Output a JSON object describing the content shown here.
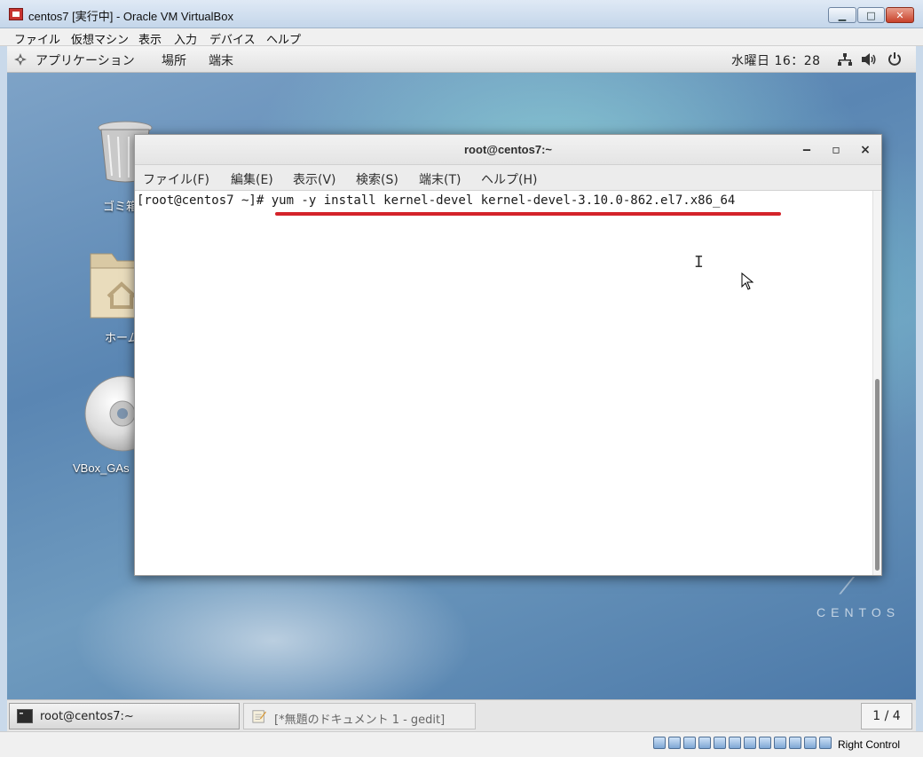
{
  "host_window": {
    "title": "centos7 [実行中] - Oracle VM VirtualBox",
    "controls": {
      "minimize": "▁",
      "maximize": "□",
      "close": "✕"
    },
    "menu": [
      "ファイル",
      "仮想マシン",
      "表示",
      "入力",
      "デバイス",
      "ヘルプ"
    ]
  },
  "gnome_topbar": {
    "applications": "アプリケーション",
    "places": "場所",
    "terminal": "端末",
    "clock": "水曜日 16：28",
    "icons": [
      "network-icon",
      "volume-icon",
      "power-icon"
    ]
  },
  "desktop": {
    "icons": [
      {
        "label": "ゴミ箱",
        "icon": "trash-icon"
      },
      {
        "label": "ホーム",
        "icon": "home-folder-icon"
      },
      {
        "label": "VBox_GAs",
        "icon": "cd-disc-icon"
      }
    ],
    "brand": "CENTOS"
  },
  "terminal": {
    "title": "root@centos7:~",
    "controls": {
      "minimize": "‒",
      "maximize": "▫",
      "close": "×"
    },
    "menu": [
      "ファイル(F)",
      "編集(E)",
      "表示(V)",
      "検索(S)",
      "端末(T)",
      "ヘルプ(H)"
    ],
    "prompt": "[root@centos7 ~]# ",
    "command": "yum -y install kernel-devel kernel-devel-3.10.0-862.el7.x86_64",
    "highlight_color": "#d4232a"
  },
  "taskbar": {
    "items": [
      {
        "label": "root@centos7:~",
        "icon": "terminal-icon",
        "active": true
      },
      {
        "label": "[*無題のドキュメント 1 - gedit]",
        "icon": "gedit-icon",
        "active": false
      }
    ],
    "workspace": "1 / 4"
  },
  "statusbar": {
    "host_key": "Right Control"
  }
}
